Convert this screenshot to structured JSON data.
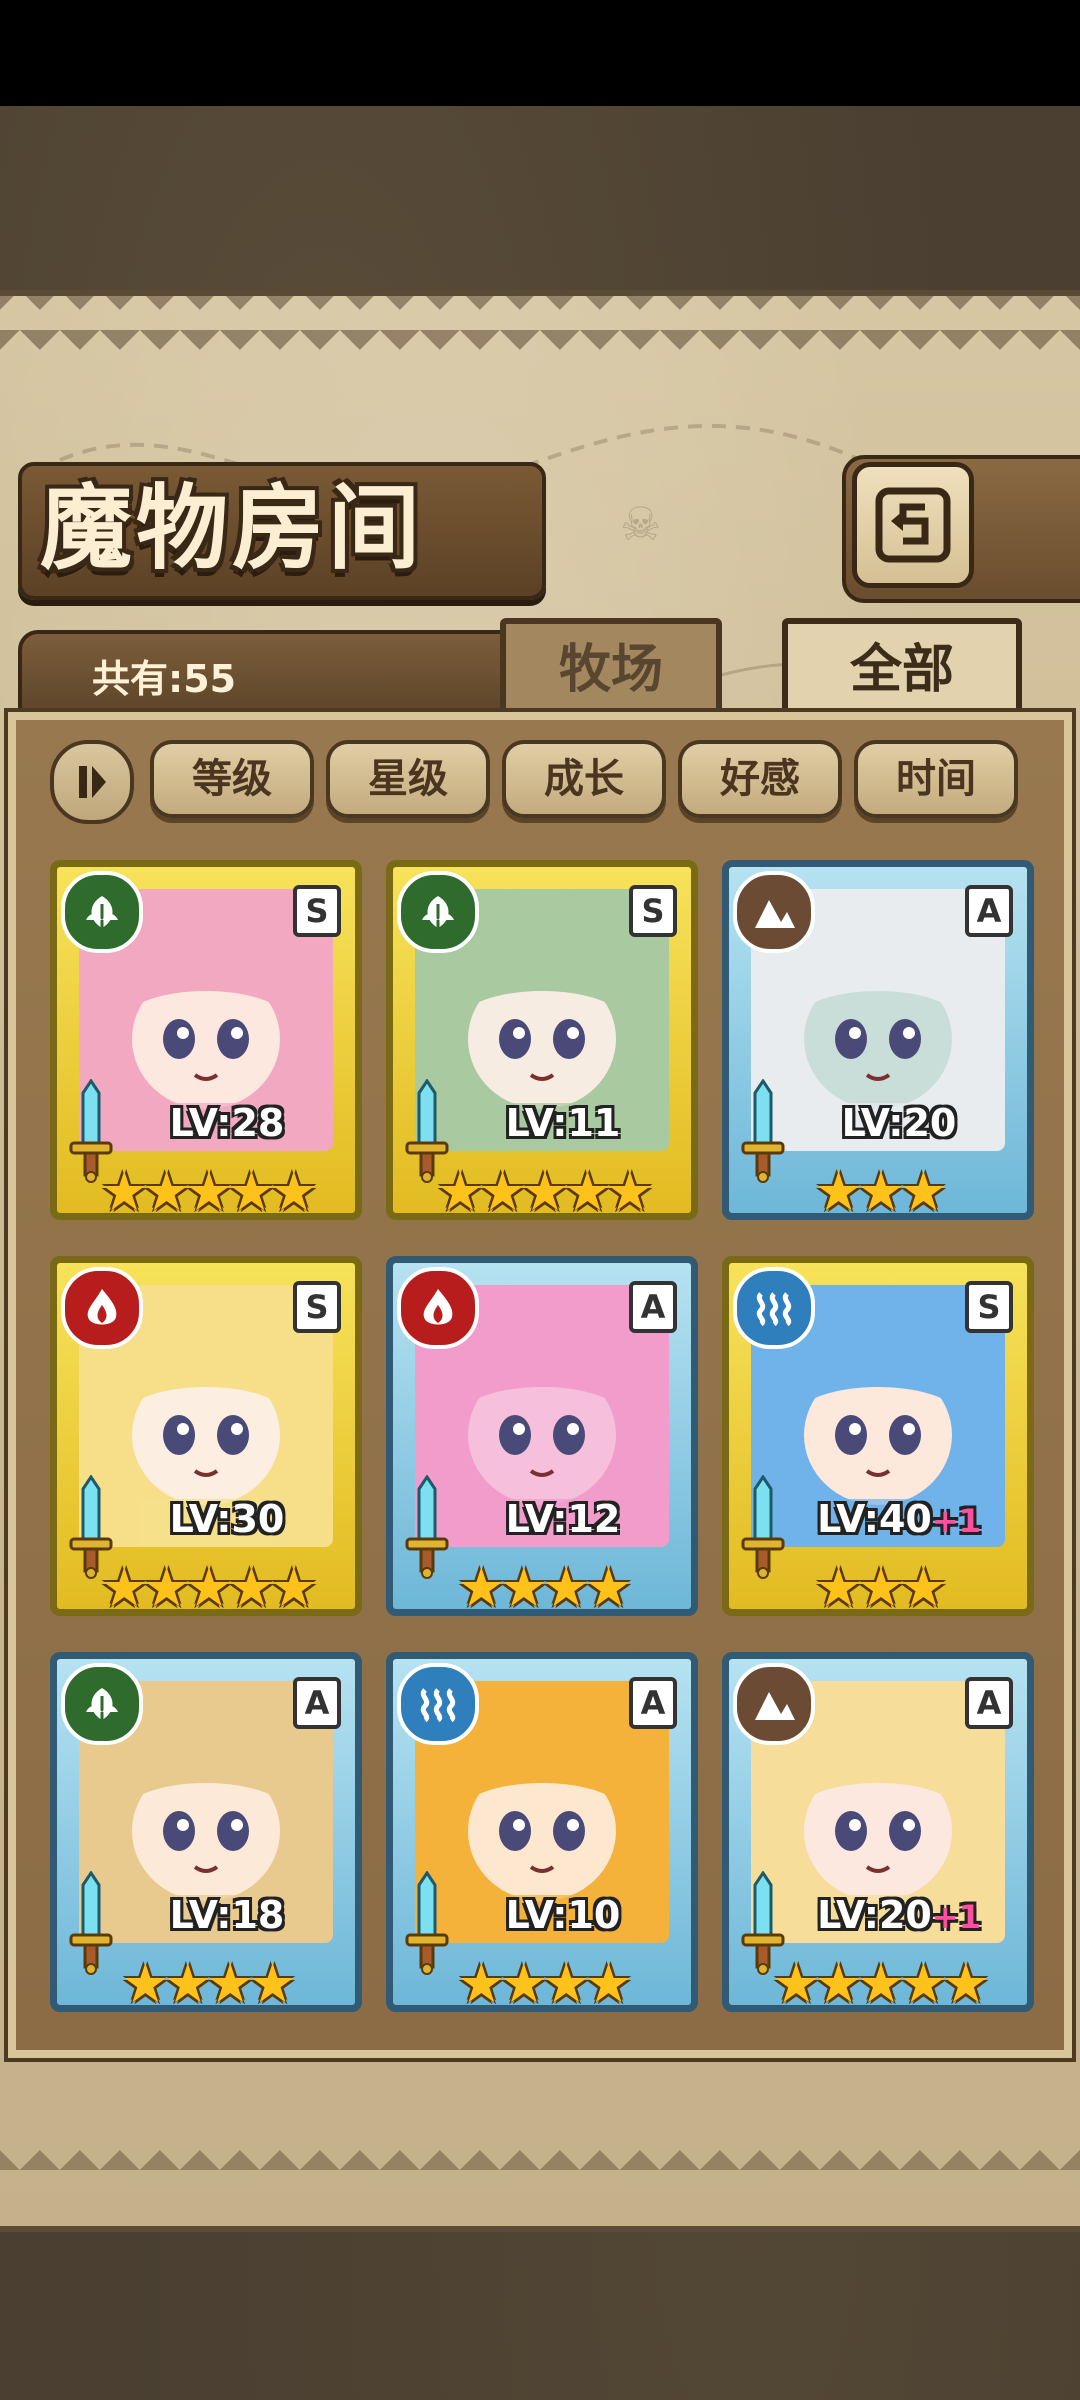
{
  "header": {
    "title": "魔物房间",
    "back_icon": "return-arrow-icon"
  },
  "summary": {
    "count_label": "共有:55"
  },
  "tabs": [
    {
      "label": "牧场",
      "active": false
    },
    {
      "label": "全部",
      "active": true
    }
  ],
  "filters": {
    "toggle_icon": "pause-sort-icon",
    "items": [
      "等级",
      "星级",
      "成长",
      "好感",
      "时间"
    ]
  },
  "monsters": [
    {
      "element": "grass",
      "rank": "S",
      "level": "LV:28",
      "bonus": "",
      "stars": "★★★★★",
      "star_count": 5,
      "frame": "gold",
      "hair": "#f2a8c0",
      "skin": "#fde8e0"
    },
    {
      "element": "grass",
      "rank": "S",
      "level": "LV:11",
      "bonus": "",
      "stars": "★★★★★",
      "star_count": 5,
      "frame": "gold",
      "hair": "#a9c9a0",
      "skin": "#f7ece2"
    },
    {
      "element": "rock",
      "rank": "A",
      "level": "LV:20",
      "bonus": "",
      "stars": "★★★",
      "star_count": 3,
      "frame": "blue",
      "hair": "#e8ecef",
      "skin": "#c9ded9"
    },
    {
      "element": "fire",
      "rank": "S",
      "level": "LV:30",
      "bonus": "",
      "stars": "★★★★★",
      "star_count": 5,
      "frame": "gold",
      "hair": "#f7df8a",
      "skin": "#fdeee2"
    },
    {
      "element": "fire",
      "rank": "A",
      "level": "LV:12",
      "bonus": "",
      "stars": "★★★★",
      "star_count": 4,
      "frame": "blue",
      "hair": "#f29ccb",
      "skin": "#f6c0dc"
    },
    {
      "element": "water",
      "rank": "S",
      "level": "LV:40",
      "bonus": "+1",
      "stars": "★★★",
      "star_count": 3,
      "frame": "gold",
      "hair": "#6fb3ea",
      "skin": "#fde8dc"
    },
    {
      "element": "grass",
      "rank": "A",
      "level": "LV:18",
      "bonus": "",
      "stars": "★★★★",
      "star_count": 4,
      "frame": "blue",
      "hair": "#e8c98e",
      "skin": "#fde9d8"
    },
    {
      "element": "water",
      "rank": "A",
      "level": "LV:10",
      "bonus": "",
      "stars": "★★★★",
      "star_count": 4,
      "frame": "blue",
      "hair": "#f4b23b",
      "skin": "#fde7cf"
    },
    {
      "element": "rock",
      "rank": "A",
      "level": "LV:20",
      "bonus": "+1",
      "stars": "★★★★★",
      "star_count": 5,
      "frame": "blue",
      "hair": "#f6de9a",
      "skin": "#fde8e0"
    }
  ],
  "colors": {
    "panel": "#cdbb93",
    "frame_gold": "#f1d43e",
    "frame_blue": "#8ccbe6",
    "star": "#ffc21a",
    "bonus": "#ff4fa0"
  }
}
